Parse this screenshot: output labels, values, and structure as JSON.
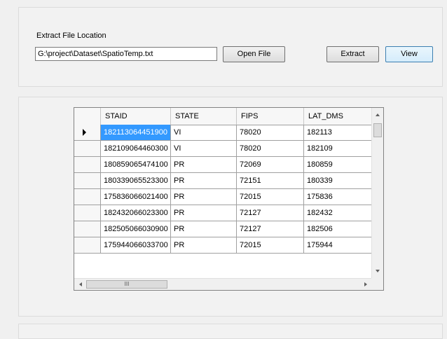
{
  "extract": {
    "label": "Extract File Location",
    "path": "G:\\project\\Dataset\\SpatioTemp.txt",
    "open_button": "Open File",
    "extract_button": "Extract",
    "view_button": "View"
  },
  "grid": {
    "columns": [
      "STAID",
      "STATE",
      "FIPS",
      "LAT_DMS"
    ],
    "rows": [
      [
        "182113064451900",
        "VI",
        "78020",
        "182113"
      ],
      [
        "182109064460300",
        "VI",
        "78020",
        "182109"
      ],
      [
        "180859065474100",
        "PR",
        "72069",
        "180859"
      ],
      [
        "180339065523300",
        "PR",
        "72151",
        "180339"
      ],
      [
        "175836066021400",
        "PR",
        "72015",
        "175836"
      ],
      [
        "182432066023300",
        "PR",
        "72127",
        "182432"
      ],
      [
        "182505066030900",
        "PR",
        "72127",
        "182506"
      ],
      [
        "175944066033700",
        "PR",
        "72015",
        "175944"
      ]
    ],
    "selected_row": 0,
    "hscroll_thumb_label": "III"
  },
  "colors": {
    "selection": "#3399ff",
    "view_button_border": "#3c7fb1"
  }
}
